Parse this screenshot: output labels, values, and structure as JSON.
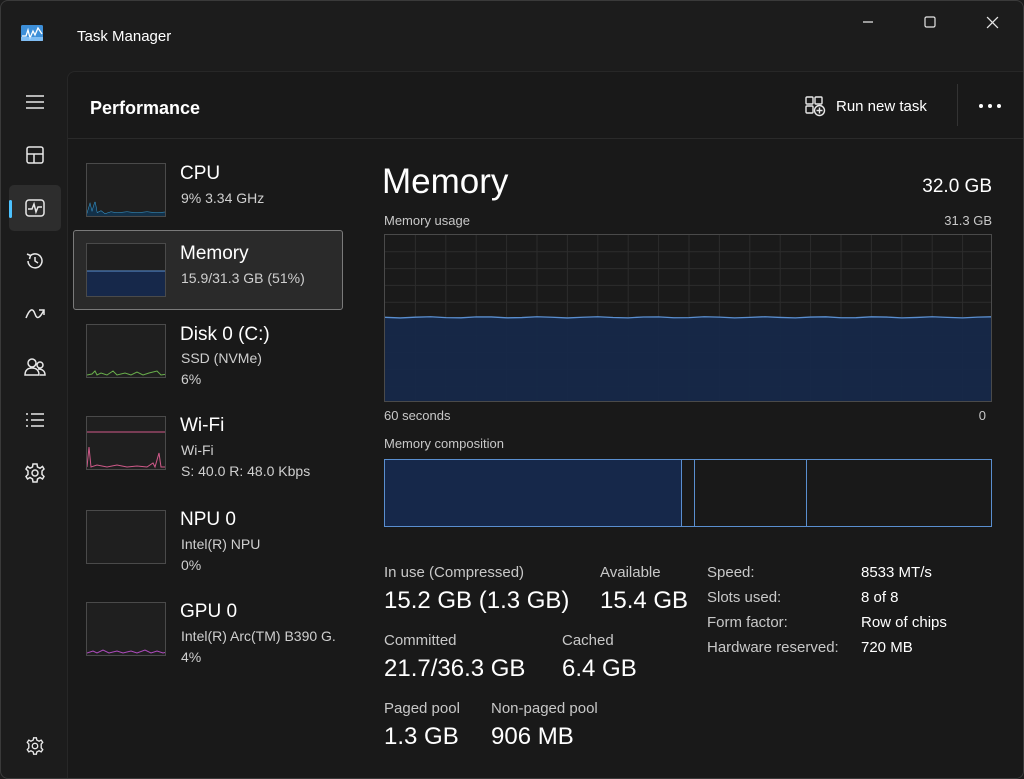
{
  "app": {
    "title": "Task Manager"
  },
  "header": {
    "page_title": "Performance",
    "run_task_label": "Run new task"
  },
  "nav": {
    "items": [
      "menu-icon",
      "processes-icon",
      "performance-icon",
      "app-history-icon",
      "startup-apps-icon",
      "users-icon",
      "details-icon",
      "services-icon",
      "settings-icon"
    ],
    "active": "performance-icon"
  },
  "resources": [
    {
      "name": "CPU",
      "line1": "9%  3.34 GHz",
      "line2": "",
      "color": "#3aa0d8"
    },
    {
      "name": "Memory",
      "line1": "15.9/31.3 GB (51%)",
      "line2": "",
      "color": "#5a8fd0"
    },
    {
      "name": "Disk 0 (C:)",
      "line1": "SSD (NVMe)",
      "line2": "6%",
      "color": "#6ab04c"
    },
    {
      "name": "Wi-Fi",
      "line1": "Wi-Fi",
      "line2": "S: 40.0  R: 48.0 Kbps",
      "color": "#d05a8a"
    },
    {
      "name": "NPU 0",
      "line1": "Intel(R) NPU",
      "line2": "0%",
      "color": "#3aa0d8"
    },
    {
      "name": "GPU 0",
      "line1": "Intel(R) Arc(TM) B390 G.",
      "line2": "4%",
      "color": "#b04cc0"
    }
  ],
  "memory": {
    "title": "Memory",
    "total": "32.0 GB",
    "usage_label": "Memory usage",
    "usage_max": "31.3 GB",
    "time_left": "60 seconds",
    "time_right": "0",
    "composition_label": "Memory composition",
    "usage_fraction": 0.51,
    "stats": {
      "in_use_label": "In use (Compressed)",
      "in_use": "15.2 GB (1.3 GB)",
      "available_label": "Available",
      "available": "15.4 GB",
      "committed_label": "Committed",
      "committed": "21.7/36.3 GB",
      "cached_label": "Cached",
      "cached": "6.4 GB",
      "paged_label": "Paged pool",
      "paged": "1.3 GB",
      "nonpaged_label": "Non-paged pool",
      "nonpaged": "906 MB"
    },
    "props": {
      "speed_label": "Speed:",
      "speed": "8533 MT/s",
      "slots_label": "Slots used:",
      "slots": "8 of 8",
      "form_label": "Form factor:",
      "form": "Row of chips",
      "hw_label": "Hardware reserved:",
      "hw": "720 MB"
    }
  },
  "colors": {
    "accent": "#4cc2ff",
    "memory_line": "#5a8fd0",
    "memory_fill": "#16284a"
  }
}
